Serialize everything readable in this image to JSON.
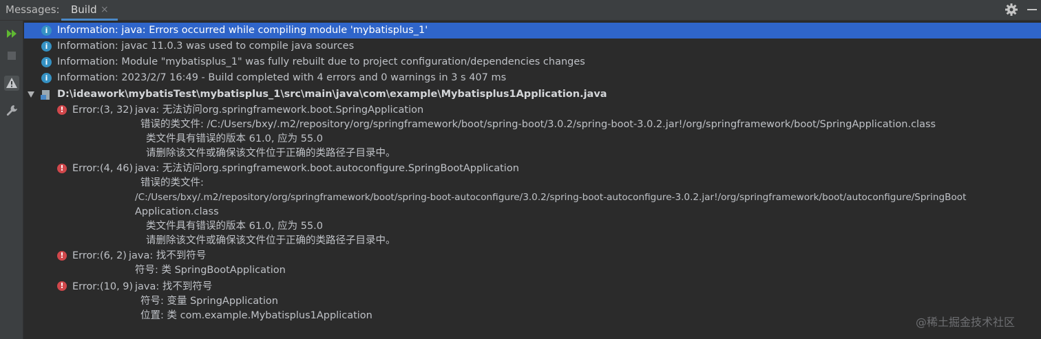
{
  "toolbar": {
    "messages_label": "Messages:",
    "tab_label": "Build",
    "tab_close": "×"
  },
  "sidebar": {
    "icons": [
      "rerun-icon",
      "stop-icon",
      "warning-filter-icon",
      "wrench-icon"
    ]
  },
  "info_rows": [
    "Information: java: Errors occurred while compiling module 'mybatisplus_1'",
    "Information: javac 11.0.3 was used to compile java sources",
    "Information: Module \"mybatisplus_1\" was fully rebuilt due to project configuration/dependencies changes",
    "Information: 2023/2/7 16:49 - Build completed with 4 errors and 0 warnings in 3 s 407 ms"
  ],
  "file_path": "D:\\ideawork\\mybatisTest\\mybatisplus_1\\src\\main\\java\\com\\example\\Mybatisplus1Application.java",
  "errors": [
    {
      "code": "Error:(3, 32)",
      "message": "java: 无法访问org.springframework.boot.SpringApplication",
      "details": [
        "错误的类文件: /C:/Users/bxy/.m2/repository/org/springframework/boot/spring-boot/3.0.2/spring-boot-3.0.2.jar!/org/springframework/boot/SpringApplication.class",
        "类文件具有错误的版本 61.0, 应为 55.0",
        "请删除该文件或确保该文件位于正确的类路径子目录中。"
      ]
    },
    {
      "code": "Error:(4, 46)",
      "message": "java: 无法访问org.springframework.boot.autoconfigure.SpringBootApplication",
      "details": [
        "错误的类文件:",
        "/C:/Users/bxy/.m2/repository/org/springframework/boot/spring-boot-autoconfigure/3.0.2/spring-boot-autoconfigure-3.0.2.jar!/org/springframework/boot/autoconfigure/SpringBoot",
        "Application.class",
        "类文件具有错误的版本 61.0, 应为 55.0",
        "请删除该文件或确保该文件位于正确的类路径子目录中。"
      ]
    },
    {
      "code": "Error:(6, 2)",
      "message": "java: 找不到符号",
      "details": [
        "符号: 类 SpringBootApplication"
      ]
    },
    {
      "code": "Error:(10, 9)",
      "message": "java: 找不到符号",
      "details": [
        "符号:   变量 SpringApplication",
        "位置: 类 com.example.Mybatisplus1Application"
      ]
    }
  ],
  "watermark": "@稀土掘金技术社区"
}
